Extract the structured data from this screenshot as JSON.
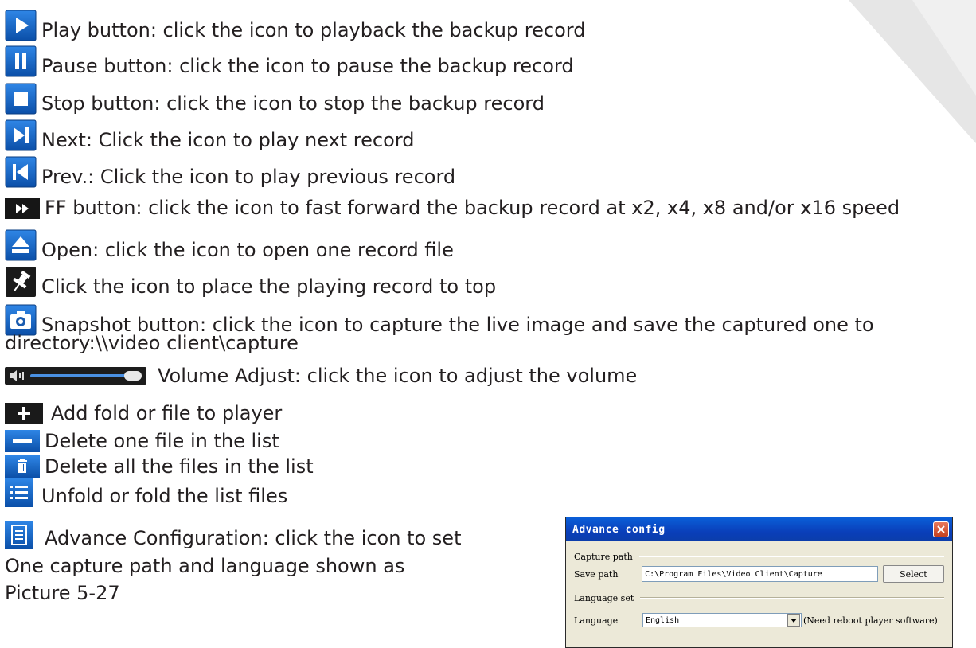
{
  "items": [
    {
      "icon": "play-icon",
      "text": "Play button: click the icon to playback the backup record"
    },
    {
      "icon": "pause-icon",
      "text": "Pause button: click the icon to pause the backup record"
    },
    {
      "icon": "stop-icon",
      "text": "Stop button: click the icon to stop the backup record"
    },
    {
      "icon": "next-icon",
      "text": "Next: Click the icon to play next record"
    },
    {
      "icon": "prev-icon",
      "text": "Prev.: Click the icon to play previous record"
    },
    {
      "icon": "fast-forward-icon",
      "text": "FF button: click the icon to fast forward the backup record at x2, x4, x8 and/or x16 speed"
    },
    {
      "icon": "eject-icon",
      "text": "Open: click the icon to open one record file"
    },
    {
      "icon": "pin-icon",
      "text": "Click the icon to place the playing record to top"
    },
    {
      "icon": "camera-icon",
      "text": "Snapshot button: click the icon to capture the live image and save the captured one to",
      "text2": "directory:\\\\video client\\capture"
    },
    {
      "icon": "volume-icon",
      "text": "Volume Adjust: click the icon to adjust the volume"
    },
    {
      "icon": "add-icon",
      "text": "Add fold or file to player"
    },
    {
      "icon": "minus-icon",
      "text": "Delete one file in the list"
    },
    {
      "icon": "trash-icon",
      "text": "Delete all the files in the list"
    },
    {
      "icon": "list-icon",
      "text": "Unfold or fold the list files"
    },
    {
      "icon": "document-icon",
      "text": "Advance Configuration: click the icon to set",
      "text2": "One capture path and language shown as",
      "text3": "Picture 5-27"
    }
  ],
  "dialog": {
    "title": "Advance config",
    "capture_section": "Capture path",
    "save_path_label": "Save path",
    "save_path_value": "C:\\Program Files\\Video Client\\Capture",
    "select_button": "Select",
    "language_section": "Language set",
    "language_label": "Language",
    "language_value": "English",
    "language_note": "(Need reboot player software)"
  },
  "colors": {
    "icon_blue": "#1a6fd1",
    "dark": "#1c1c1c",
    "title_blue": "#0a4fcf",
    "dialog_bg": "#ece9d8"
  }
}
